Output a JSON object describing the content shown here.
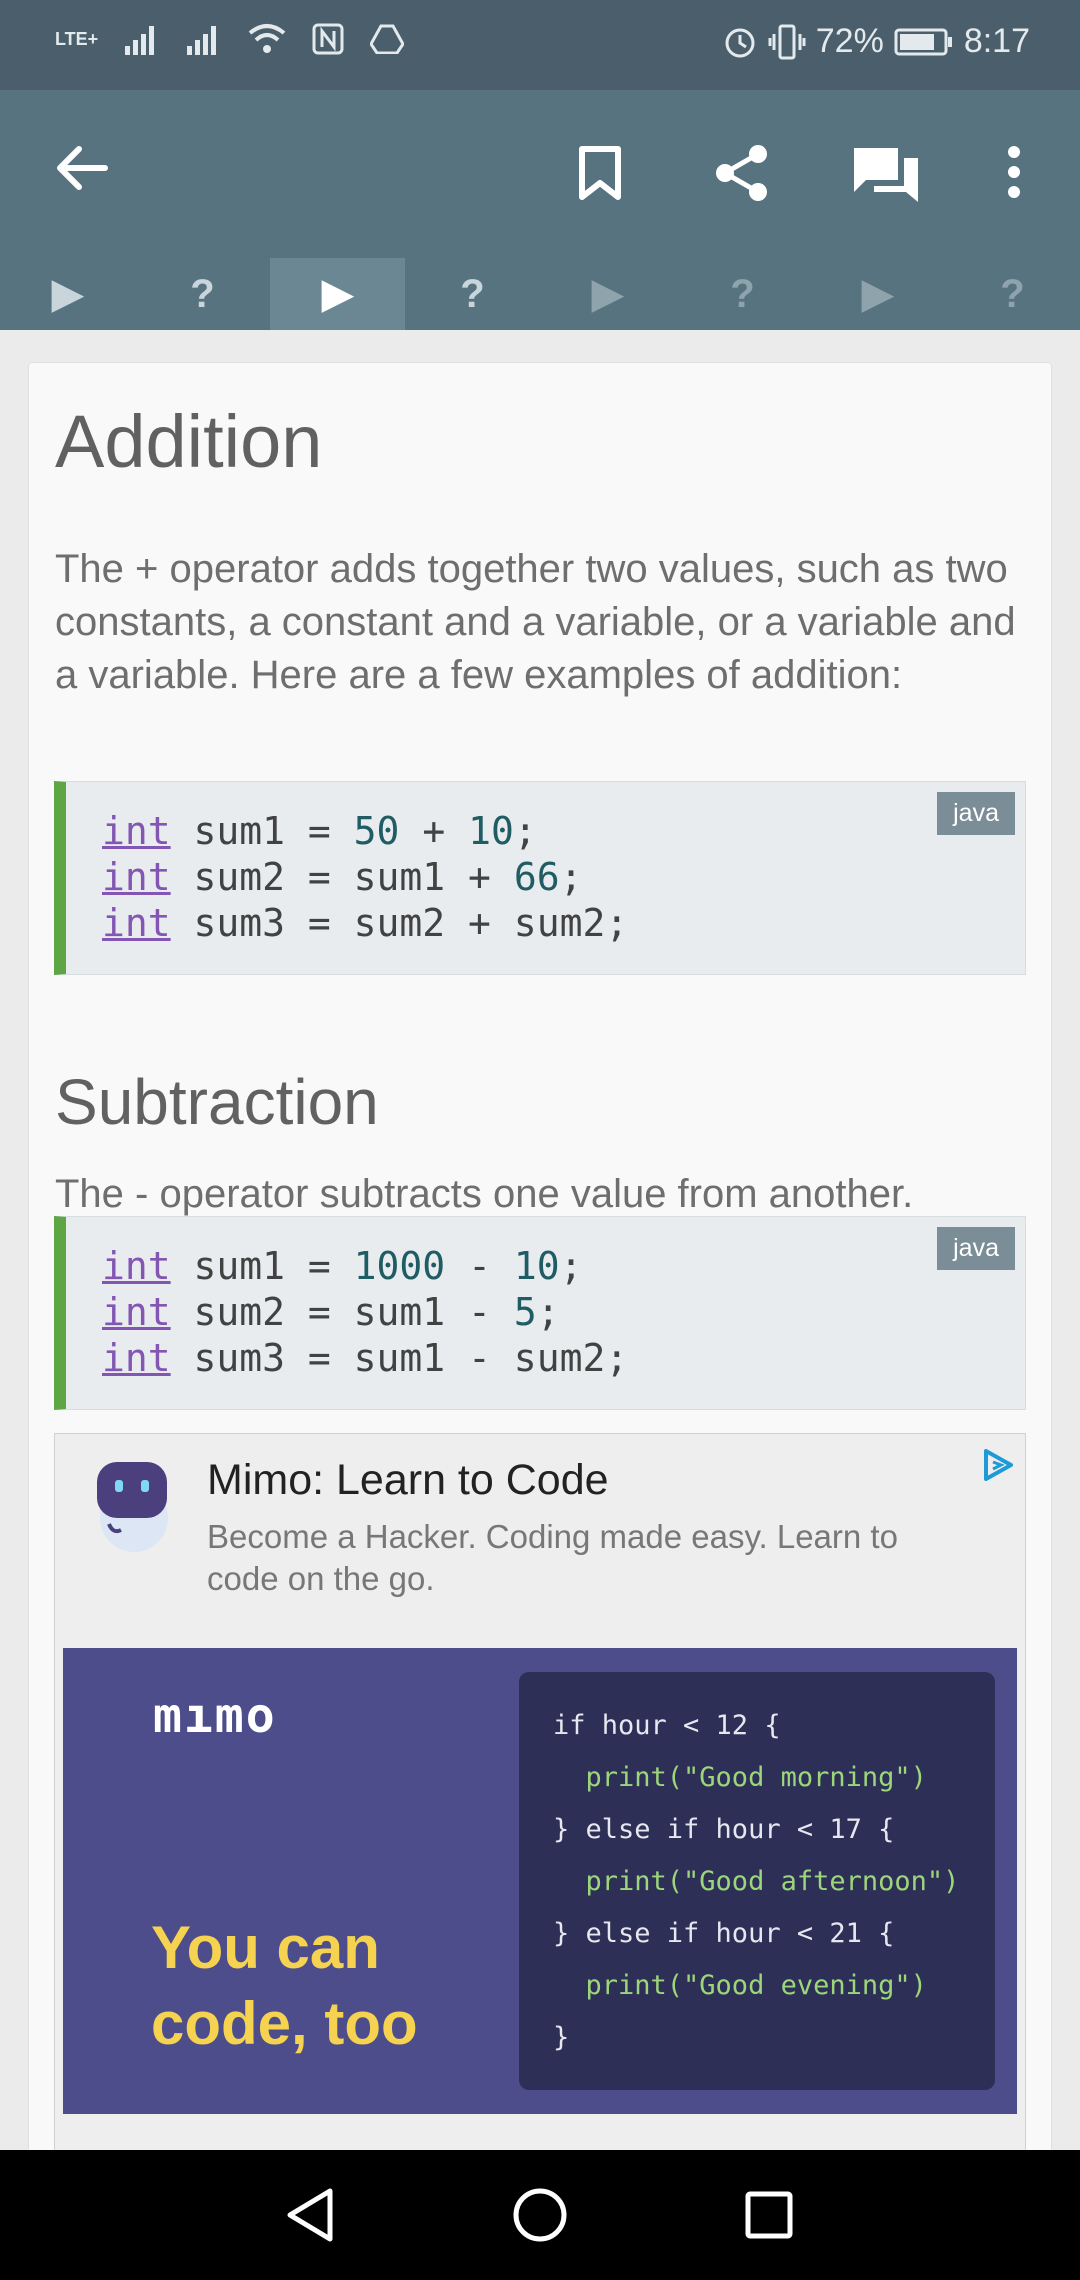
{
  "status_bar": {
    "network": "LTE+",
    "battery": "72%",
    "time": "8:17"
  },
  "toolbar": {
    "icons": [
      "back-arrow-icon",
      "bookmark-icon",
      "share-icon",
      "comments-icon",
      "more-vert-icon"
    ]
  },
  "lesson_tabs": [
    {
      "icon": "play",
      "glyph": "▶"
    },
    {
      "icon": "quiz",
      "glyph": "?"
    },
    {
      "icon": "play",
      "glyph": "▶",
      "active": true
    },
    {
      "icon": "quiz",
      "glyph": "?"
    },
    {
      "icon": "play",
      "glyph": "▶"
    },
    {
      "icon": "quiz",
      "glyph": "?"
    },
    {
      "icon": "play",
      "glyph": "▶"
    },
    {
      "icon": "quiz",
      "glyph": "?"
    }
  ],
  "sections": {
    "addition": {
      "title": "Addition",
      "text": "The + operator adds together two values, such as two constants, a constant and a variable, or a variable and a variable. Here are a few examples of addition:",
      "code_lang": "java",
      "code": [
        {
          "kw": "int",
          "rest_pre": " sum1 = ",
          "num": "50",
          "rest_mid": " + ",
          "num2": "10",
          "tail": ";"
        },
        {
          "kw": "int",
          "rest_pre": " sum2 = sum1 + ",
          "num": "66",
          "tail": ";"
        },
        {
          "kw": "int",
          "rest_pre": " sum3 = sum2 + sum2;"
        }
      ]
    },
    "subtraction": {
      "title": "Subtraction",
      "text": "The - operator subtracts one value from another.",
      "code_lang": "java",
      "code": [
        {
          "kw": "int",
          "rest_pre": " sum1 = ",
          "num": "1000",
          "rest_mid": " - ",
          "num2": "10",
          "tail": ";"
        },
        {
          "kw": "int",
          "rest_pre": " sum2 = sum1 - ",
          "num": "5",
          "tail": ";"
        },
        {
          "kw": "int",
          "rest_pre": " sum3 = sum1 - sum2;"
        }
      ]
    }
  },
  "ad": {
    "title": "Mimo: Learn to Code",
    "description": "Become a Hacker. Coding made easy. Learn to code on the go.",
    "banner_logo": "mımo",
    "banner_tagline": "You can code, too",
    "banner_code": [
      "if hour < 12 {",
      "  print(\"Good morning\")",
      "} else if hour < 17 {",
      "  print(\"Good afternoon\")",
      "} else if hour < 21 {",
      "  print(\"Good evening\")",
      "}"
    ]
  },
  "colors": {
    "status_bar": "#4a5f6b",
    "app_bar": "#587380",
    "code_accent": "#5ea644",
    "keyword": "#8456b3",
    "banner_bg": "#4c4d8a",
    "tagline": "#f5d250"
  }
}
